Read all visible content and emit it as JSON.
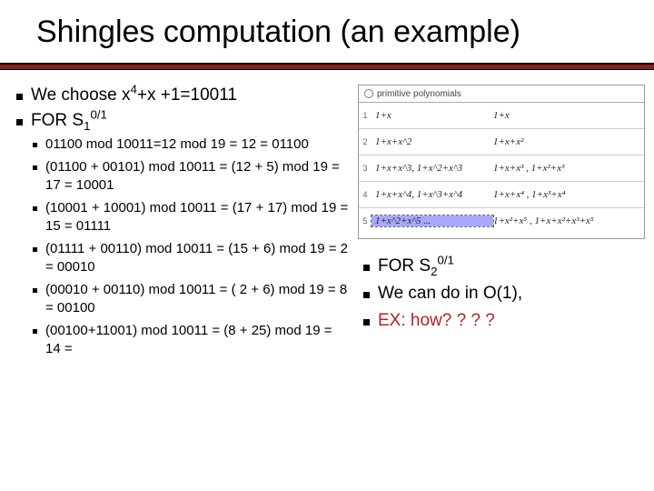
{
  "title_a": "Shingles computation ",
  "title_b": "(an example)",
  "left": {
    "l1_pre": "We choose x",
    "l1_post": "+x +1=10011",
    "l2_pre": "FOR S",
    "l2_sup": "0/1",
    "items": [
      "01100 mod 10011=12 mod 19 = 12 = 01100",
      "(01100 + 00101) mod 10011 = (12 + 5) mod 19 = 17 = 10001",
      "(10001 + 10001) mod 10011 = (17 + 17) mod 19 = 15 = 01111",
      "(01111 + 00110) mod 10011 = (15 + 6) mod 19 = 2 = 00010",
      "(00010 + 00110) mod 10011 =    ( 2 + 6) mod 19 = 8 = 00100",
      "(00100+11001) mod 10011 =   (8 + 25) mod 19 = 14 ="
    ]
  },
  "chart": {
    "header": "primitive polynomials",
    "rows": [
      {
        "idx": "1",
        "f": "1+x",
        "r": "1+x"
      },
      {
        "idx": "2",
        "f": "1+x+x^2",
        "r": "1+x+x²"
      },
      {
        "idx": "3",
        "f": "1+x+x^3, 1+x^2+x^3",
        "r": "1+x+x³ , 1+x²+x³"
      },
      {
        "idx": "4",
        "f": "1+x+x^4, 1+x^3+x^4",
        "r": "1+x+x⁴ , 1+x³+x⁴"
      },
      {
        "idx": "5",
        "f": "1+x^2+x^5 ...",
        "r": "1+x²+x⁵ , 1+x+x²+x³+x⁵"
      }
    ]
  },
  "right": {
    "r1_pre": "FOR S",
    "r1_sup": "0/1",
    "r2": "We can do in O(1),",
    "r3": "EX: how? ? ? ?"
  }
}
